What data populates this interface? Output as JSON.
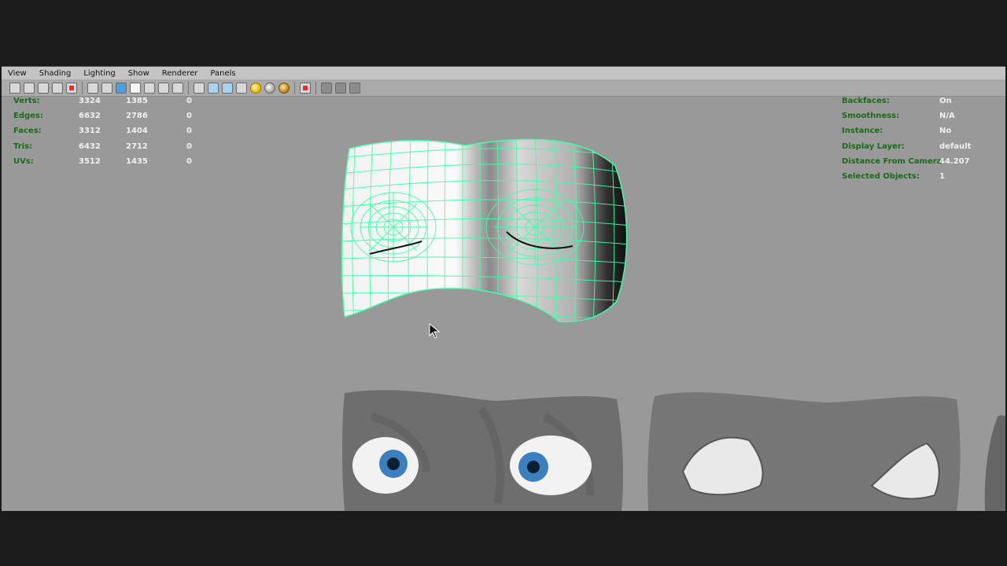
{
  "menu": [
    "View",
    "Shading",
    "Lighting",
    "Show",
    "Renderer",
    "Panels"
  ],
  "toolbar_icons": [
    "select-camera-icon",
    "camera-attributes-icon",
    "bookmark-icon",
    "image-plane-icon",
    "film-gate-icon",
    "grid-icon",
    "resolution-gate-icon",
    "wireframe-icon",
    "smooth-shade-icon",
    "default-lighting-icon",
    "textured-icon",
    "xray-icon",
    "isolate-select-icon",
    "wireframe-on-shaded-icon",
    "xray-joints-icon",
    "all-lights-icon",
    "shadows-icon",
    "high-quality-icon",
    "use-default-material-icon",
    "screen-space-ao-icon",
    "motion-blur-icon",
    "multisample-icon"
  ],
  "hud_left": {
    "rows": [
      {
        "label": "Verts:",
        "a": "3324",
        "b": "1385",
        "c": "0"
      },
      {
        "label": "Edges:",
        "a": "6632",
        "b": "2786",
        "c": "0"
      },
      {
        "label": "Faces:",
        "a": "3312",
        "b": "1404",
        "c": "0"
      },
      {
        "label": "Tris:",
        "a": "6432",
        "b": "2712",
        "c": "0"
      },
      {
        "label": "UVs:",
        "a": "3512",
        "b": "1435",
        "c": "0"
      }
    ]
  },
  "hud_right": {
    "rows": [
      {
        "label": "Backfaces:",
        "value": "On"
      },
      {
        "label": "Smoothness:",
        "value": "N/A"
      },
      {
        "label": "Instance:",
        "value": "No"
      },
      {
        "label": "Display Layer:",
        "value": "default"
      },
      {
        "label": "Distance From Camera:",
        "value": "44.207"
      },
      {
        "label": "Selected Objects:",
        "value": "1"
      }
    ]
  },
  "colors": {
    "viewport_bg": "#999999",
    "wireframe": "#3fffa8",
    "hud_label": "#1a6b1a",
    "hud_value": "#f0f0f0",
    "eye_iris": "#3c7fbe"
  }
}
